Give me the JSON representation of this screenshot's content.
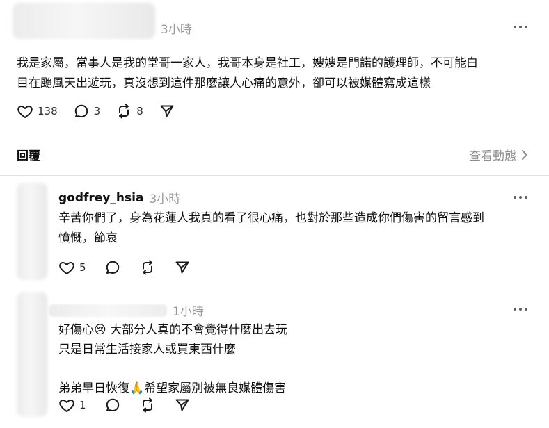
{
  "app": {
    "section_title": "回覆",
    "view_activity": "查看動態"
  },
  "top_post": {
    "time": "3小時",
    "text": "我是家屬，當事人是我的堂哥一家人，我哥本身是社工，嫂嫂是門諾的護理師，不可能白\n目在颱風天出遊玩，真沒想到這件那麼讓人心痛的意外，卻可以被媒體寫成這樣",
    "likes": "138",
    "replies": "3",
    "reposts": "8"
  },
  "replies": [
    {
      "username": "godfrey_hsia",
      "time": "3小時",
      "text": "辛苦你們了，身為花蓮人我真的看了很心痛，也對於那些造成你們傷害的留言感到\n憤慨，節哀",
      "likes": "5"
    },
    {
      "username": "",
      "time": "1小時",
      "text": "好傷心😢 大部分人真的不會覺得什麼出去玩\n只是日常生活接家人或買東西什麼\n\n弟弟早日恢復🙏希望家屬別被無良媒體傷害",
      "likes": "1"
    }
  ],
  "icons": {
    "heart": "heart-icon",
    "reply": "comment-icon",
    "repost": "repost-icon",
    "share": "share-icon",
    "more": "more-icon",
    "chevron": "chevron-right-icon"
  },
  "colors": {
    "text": "#111111",
    "muted": "#8e8e8e",
    "divider": "#e3e3e3",
    "background": "#ffffff"
  }
}
